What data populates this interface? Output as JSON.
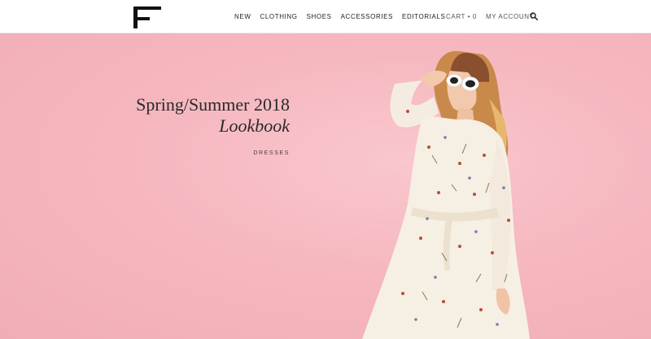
{
  "logo": {
    "letter": "F"
  },
  "nav": {
    "main": [
      {
        "label": "NEW"
      },
      {
        "label": "CLOTHING"
      },
      {
        "label": "SHOES"
      },
      {
        "label": "ACCESSORIES"
      },
      {
        "label": "EDITORIALS"
      }
    ],
    "cart_label": "CART • 0",
    "account_label": "MY ACCOUNT",
    "search_icon": "search-icon"
  },
  "hero": {
    "title_line1": "Spring/Summer 2018",
    "title_line2": "Lookbook",
    "category": "DRESSES"
  },
  "colors": {
    "hero_background": "#f6b7bf",
    "text_dark": "#222222"
  }
}
